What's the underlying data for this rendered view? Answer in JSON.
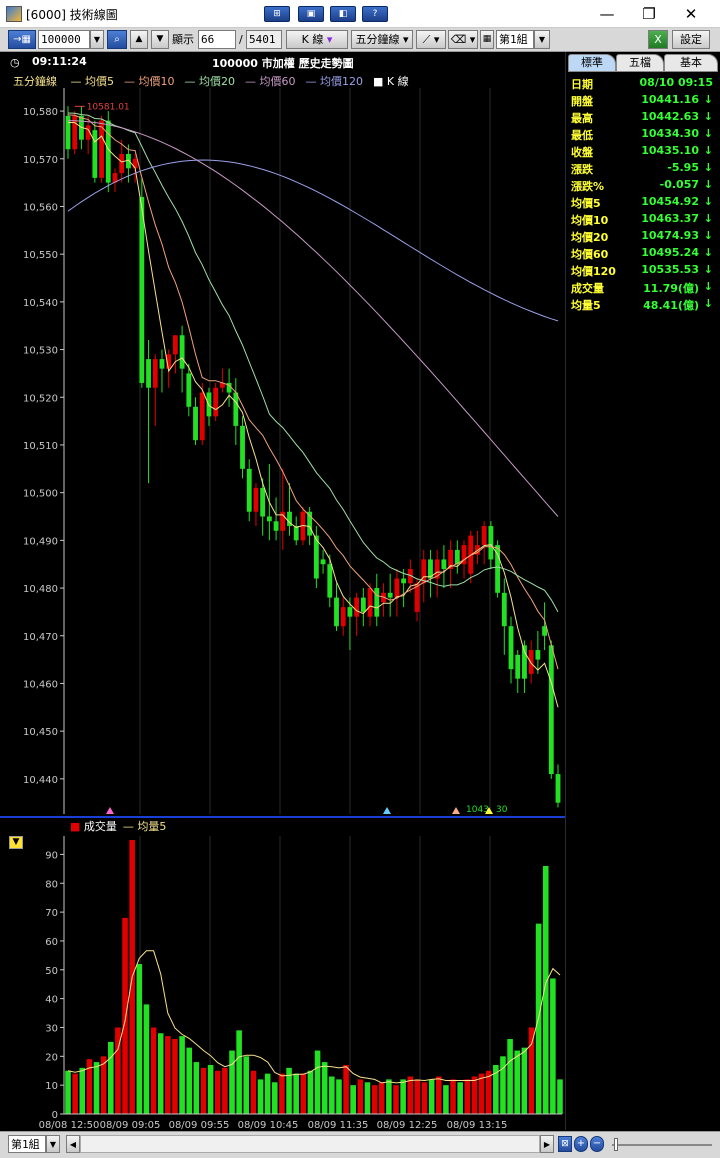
{
  "window": {
    "title": "[6000] 技術線圖",
    "toolbar_icons": [
      "display-mode-icon",
      "layout-icon",
      "video-icon",
      "help-icon"
    ],
    "controls": {
      "minimize": "—",
      "restore": "❐",
      "close": "✕"
    }
  },
  "toolbar": {
    "symbol_value": "100000",
    "display_label": "顯示",
    "display_count": "66",
    "total_count": "5401",
    "chart_kind": "K 線",
    "period": "五分鐘線",
    "group": "第1組",
    "settings_label": "設定"
  },
  "chart_header": {
    "time": "09:11:24",
    "title": "100000 市加權  歷史走勢圖",
    "period_label": "五分鐘線",
    "legend": [
      {
        "name": "均價5",
        "color": "#f5e28c"
      },
      {
        "name": "均價10",
        "color": "#f0a27a"
      },
      {
        "name": "均價20",
        "color": "#9fe0a8"
      },
      {
        "name": "均價60",
        "color": "#c79ac7"
      },
      {
        "name": "均價120",
        "color": "#9aa0e8"
      },
      {
        "name": "K 線",
        "color": "#ffffff"
      }
    ],
    "high_marker": "10581.01",
    "last_marker": "1043",
    "last_marker_tail": "30"
  },
  "volume_header": {
    "legend": [
      {
        "name": "成交量",
        "color": "#e00000"
      },
      {
        "name": "均量5",
        "color": "#f5e28c"
      }
    ]
  },
  "side_panel": {
    "tabs": [
      "標準",
      "五檔",
      "基本"
    ],
    "rows": [
      {
        "label": "日期",
        "value": "08/10 09:15",
        "arrow": ""
      },
      {
        "label": "開盤",
        "value": "10441.16",
        "arrow": "↓"
      },
      {
        "label": "最高",
        "value": "10442.63",
        "arrow": "↓"
      },
      {
        "label": "最低",
        "value": "10434.30",
        "arrow": "↓"
      },
      {
        "label": "收盤",
        "value": "10435.10",
        "arrow": "↓"
      },
      {
        "label": "漲跌",
        "value": "-5.95",
        "arrow": "↓"
      },
      {
        "label": "漲跌%",
        "value": "-0.057",
        "arrow": "↓"
      },
      {
        "label": "均價5",
        "value": "10454.92",
        "arrow": "↓"
      },
      {
        "label": "均價10",
        "value": "10463.37",
        "arrow": "↓"
      },
      {
        "label": "均價20",
        "value": "10474.93",
        "arrow": "↓"
      },
      {
        "label": "均價60",
        "value": "10495.24",
        "arrow": "↓"
      },
      {
        "label": "均價120",
        "value": "10535.53",
        "arrow": "↓"
      },
      {
        "label": "成交量",
        "value": "11.79(億)",
        "arrow": "↓"
      },
      {
        "label": "均量5",
        "value": "48.41(億)",
        "arrow": "↓"
      }
    ]
  },
  "bottom_bar": {
    "group": "第1組"
  },
  "colors": {
    "up": "#e00000",
    "down": "#22e022",
    "axis": "#c8c8c8",
    "divider": "#1a3fd6",
    "grid": "#2a2a2a"
  },
  "chart_data": [
    {
      "type": "candlestick",
      "title": "100000 市加權  歷史走勢圖",
      "ylim": [
        10432,
        10584
      ],
      "yticks": [
        10440,
        10450,
        10460,
        10470,
        10480,
        10490,
        10500,
        10510,
        10520,
        10530,
        10540,
        10550,
        10560,
        10570,
        10580
      ],
      "candles": [
        {
          "o": 10579,
          "h": 10581,
          "c": 10572,
          "l": 10570
        },
        {
          "o": 10572,
          "h": 10580,
          "c": 10579,
          "l": 10571
        },
        {
          "o": 10579,
          "h": 10581,
          "c": 10574,
          "l": 10572
        },
        {
          "o": 10574,
          "h": 10579,
          "c": 10577,
          "l": 10571
        },
        {
          "o": 10576,
          "h": 10578,
          "c": 10566,
          "l": 10565
        },
        {
          "o": 10566,
          "h": 10579,
          "c": 10578,
          "l": 10565
        },
        {
          "o": 10578,
          "h": 10580,
          "c": 10565,
          "l": 10563
        },
        {
          "o": 10565,
          "h": 10568,
          "c": 10567,
          "l": 10563
        },
        {
          "o": 10567,
          "h": 10574,
          "c": 10571,
          "l": 10565
        },
        {
          "o": 10571,
          "h": 10573,
          "c": 10568,
          "l": 10565
        },
        {
          "o": 10568,
          "h": 10571,
          "c": 10570,
          "l": 10565
        },
        {
          "o": 10562,
          "h": 10566,
          "c": 10523,
          "l": 10522
        },
        {
          "o": 10528,
          "h": 10532,
          "c": 10522,
          "l": 10502
        },
        {
          "o": 10522,
          "h": 10529,
          "c": 10528,
          "l": 10514
        },
        {
          "o": 10528,
          "h": 10530,
          "c": 10526,
          "l": 10521
        },
        {
          "o": 10526,
          "h": 10530,
          "c": 10529,
          "l": 10522
        },
        {
          "o": 10529,
          "h": 10533,
          "c": 10533,
          "l": 10525
        },
        {
          "o": 10533,
          "h": 10535,
          "c": 10526,
          "l": 10521
        },
        {
          "o": 10525,
          "h": 10527,
          "c": 10518,
          "l": 10516
        },
        {
          "o": 10518,
          "h": 10520,
          "c": 10511,
          "l": 10510
        },
        {
          "o": 10511,
          "h": 10523,
          "c": 10521,
          "l": 10510
        },
        {
          "o": 10521,
          "h": 10522,
          "c": 10516,
          "l": 10514
        },
        {
          "o": 10516,
          "h": 10523,
          "c": 10522,
          "l": 10515
        },
        {
          "o": 10522,
          "h": 10526,
          "c": 10523,
          "l": 10521
        },
        {
          "o": 10523,
          "h": 10526,
          "c": 10521,
          "l": 10518
        },
        {
          "o": 10521,
          "h": 10524,
          "c": 10514,
          "l": 10510
        },
        {
          "o": 10514,
          "h": 10516,
          "c": 10505,
          "l": 10503
        },
        {
          "o": 10505,
          "h": 10507,
          "c": 10496,
          "l": 10494
        },
        {
          "o": 10496,
          "h": 10502,
          "c": 10501,
          "l": 10493
        },
        {
          "o": 10501,
          "h": 10503,
          "c": 10495,
          "l": 10491
        },
        {
          "o": 10495,
          "h": 10506,
          "c": 10494,
          "l": 10490
        },
        {
          "o": 10494,
          "h": 10499,
          "c": 10492,
          "l": 10490
        },
        {
          "o": 10492,
          "h": 10505,
          "c": 10496,
          "l": 10488
        },
        {
          "o": 10496,
          "h": 10502,
          "c": 10493,
          "l": 10491
        },
        {
          "o": 10493,
          "h": 10495,
          "c": 10490,
          "l": 10489
        },
        {
          "o": 10490,
          "h": 10497,
          "c": 10496,
          "l": 10489
        },
        {
          "o": 10496,
          "h": 10497,
          "c": 10491,
          "l": 10489
        },
        {
          "o": 10491,
          "h": 10493,
          "c": 10482,
          "l": 10480
        },
        {
          "o": 10486,
          "h": 10488,
          "c": 10485,
          "l": 10483
        },
        {
          "o": 10485,
          "h": 10487,
          "c": 10478,
          "l": 10476
        },
        {
          "o": 10478,
          "h": 10481,
          "c": 10472,
          "l": 10471
        },
        {
          "o": 10472,
          "h": 10478,
          "c": 10476,
          "l": 10470
        },
        {
          "o": 10476,
          "h": 10478,
          "c": 10474,
          "l": 10467
        },
        {
          "o": 10474,
          "h": 10479,
          "c": 10478,
          "l": 10470
        },
        {
          "o": 10478,
          "h": 10480,
          "c": 10475,
          "l": 10472
        },
        {
          "o": 10474,
          "h": 10481,
          "c": 10480,
          "l": 10472
        },
        {
          "o": 10480,
          "h": 10483,
          "c": 10474,
          "l": 10472
        },
        {
          "o": 10477,
          "h": 10481,
          "c": 10479,
          "l": 10474
        },
        {
          "o": 10479,
          "h": 10483,
          "c": 10478,
          "l": 10474
        },
        {
          "o": 10478,
          "h": 10484,
          "c": 10482,
          "l": 10474
        },
        {
          "o": 10482,
          "h": 10484,
          "c": 10481,
          "l": 10476
        },
        {
          "o": 10481,
          "h": 10486,
          "c": 10484,
          "l": 10479
        },
        {
          "o": 10475,
          "h": 10482,
          "c": 10481,
          "l": 10473
        },
        {
          "o": 10481,
          "h": 10488,
          "c": 10486,
          "l": 10477
        },
        {
          "o": 10486,
          "h": 10488,
          "c": 10482,
          "l": 10478
        },
        {
          "o": 10482,
          "h": 10488,
          "c": 10486,
          "l": 10478
        },
        {
          "o": 10486,
          "h": 10489,
          "c": 10484,
          "l": 10480
        },
        {
          "o": 10484,
          "h": 10490,
          "c": 10488,
          "l": 10480
        },
        {
          "o": 10488,
          "h": 10490,
          "c": 10485,
          "l": 10483
        },
        {
          "o": 10485,
          "h": 10490,
          "c": 10489,
          "l": 10482
        },
        {
          "o": 10483,
          "h": 10492,
          "c": 10491,
          "l": 10481
        },
        {
          "o": 10487,
          "h": 10492,
          "c": 10489,
          "l": 10485
        },
        {
          "o": 10489,
          "h": 10494,
          "c": 10493,
          "l": 10485
        },
        {
          "o": 10493,
          "h": 10494,
          "c": 10486,
          "l": 10484
        },
        {
          "o": 10489,
          "h": 10490,
          "c": 10479,
          "l": 10478
        },
        {
          "o": 10479,
          "h": 10482,
          "c": 10472,
          "l": 10466
        },
        {
          "o": 10472,
          "h": 10474,
          "c": 10463,
          "l": 10460
        },
        {
          "o": 10466,
          "h": 10467,
          "c": 10461,
          "l": 10458
        },
        {
          "o": 10468,
          "h": 10469,
          "c": 10461,
          "l": 10458
        },
        {
          "o": 10462,
          "h": 10469,
          "c": 10467,
          "l": 10460
        },
        {
          "o": 10467,
          "h": 10471,
          "c": 10465,
          "l": 10462
        },
        {
          "o": 10472,
          "h": 10477,
          "c": 10470,
          "l": 10467
        },
        {
          "o": 10468,
          "h": 10469,
          "c": 10441,
          "l": 10440
        },
        {
          "o": 10441,
          "h": 10443,
          "c": 10435,
          "l": 10434
        }
      ],
      "ma_levels": {
        "均價5_start": 10579,
        "均價5_end": 10455,
        "均價10_start": 10580,
        "均價10_end": 10463,
        "均價20_start": 10580,
        "均價20_end": 10475,
        "均價60_start": 10578,
        "均價60_end": 10495,
        "均價120_start": 10559,
        "均價120_end": 10536
      }
    },
    {
      "type": "bar",
      "title": "成交量",
      "ylim": [
        0,
        95
      ],
      "yticks": [
        0,
        10,
        20,
        30,
        40,
        50,
        60,
        70,
        80,
        90
      ],
      "xlabels": [
        "08/08 12:50",
        "08/09 09:05",
        "08/09 09:55",
        "08/09 10:45",
        "08/09 11:35",
        "08/09 12:25",
        "08/09 13:15"
      ],
      "volume": [
        15,
        14,
        16,
        19,
        18,
        20,
        25,
        30,
        68,
        95,
        52,
        38,
        30,
        28,
        27,
        26,
        27,
        23,
        18,
        16,
        17,
        15,
        16,
        22,
        29,
        20,
        15,
        12,
        14,
        11,
        14,
        16,
        14,
        14,
        15,
        22,
        18,
        13,
        12,
        17,
        10,
        12,
        11,
        10,
        11,
        12,
        10,
        12,
        13,
        12,
        11,
        12,
        13,
        10,
        12,
        11,
        12,
        13,
        14,
        15,
        17,
        20,
        26,
        22,
        23,
        30,
        66,
        86,
        47,
        12
      ]
    }
  ]
}
